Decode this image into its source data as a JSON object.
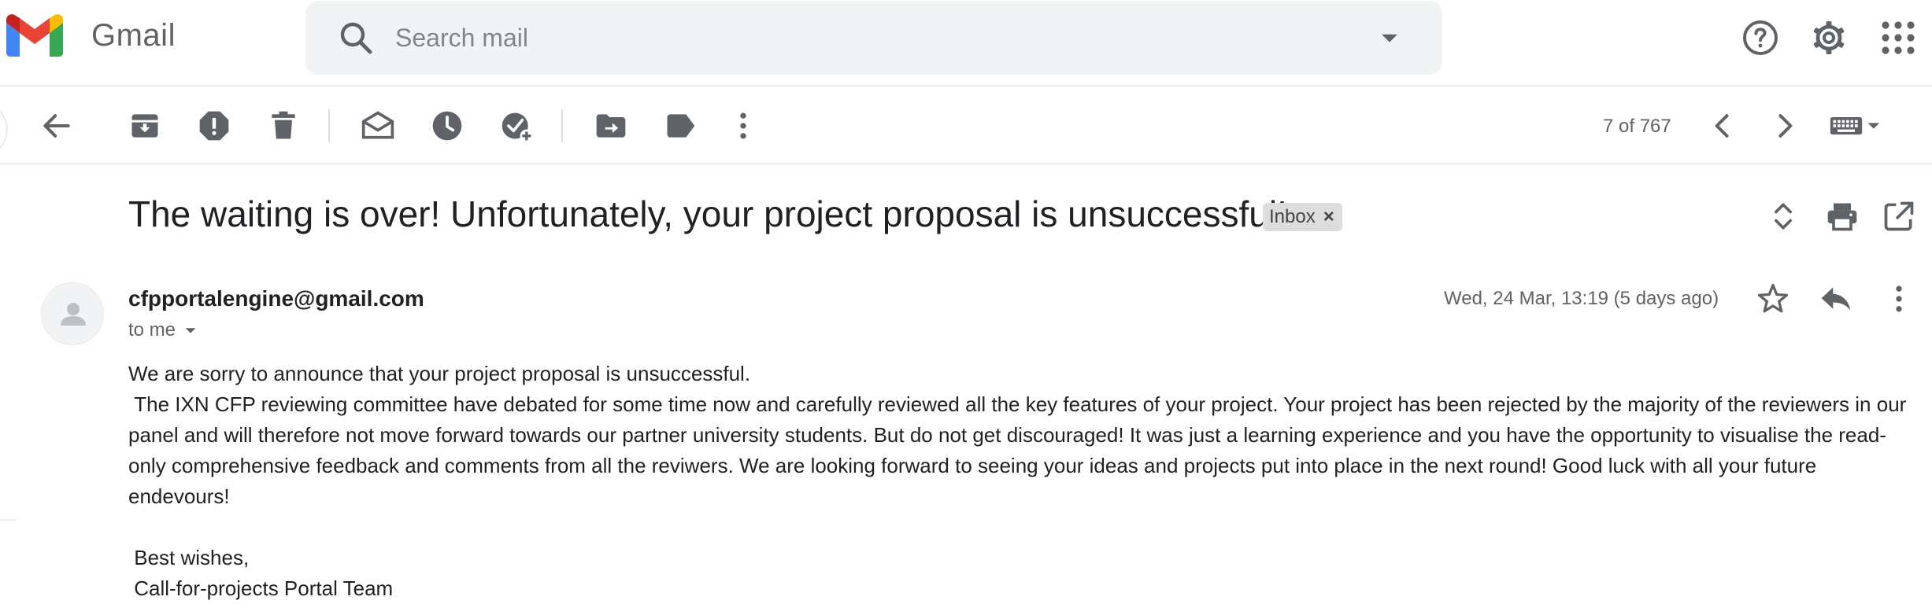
{
  "app": {
    "name": "Gmail",
    "brand_colors": {
      "red": "#ea4335",
      "blue": "#4285f4",
      "green": "#34a853",
      "yellow": "#fbbc04"
    }
  },
  "search": {
    "placeholder": "Search mail",
    "value": "",
    "icon": "search-icon",
    "options_icon": "dropdown-arrow-icon"
  },
  "header_icons": [
    "help-icon",
    "settings-icon",
    "apps-grid-icon"
  ],
  "toolbar": {
    "actions": [
      "back-arrow-icon",
      "archive-icon",
      "report-spam-icon",
      "delete-icon",
      "mark-unread-icon",
      "snooze-icon",
      "add-to-tasks-icon",
      "move-to-icon",
      "labels-icon",
      "more-vertical-icon"
    ],
    "pager": {
      "current": 7,
      "total": 767,
      "text": "7 of 767"
    },
    "input_tools": "keyboard-icon"
  },
  "email": {
    "subject": "The waiting is over! Unfortunately, your project proposal is unsuccessful!",
    "label": "Inbox",
    "label_remove": "×",
    "sender": "cfpportalengine@gmail.com",
    "recipient": "to me",
    "date": "Wed, 24 Mar, 13:19 (5 days ago)",
    "body": {
      "line1": "We are sorry to announce that your project proposal is unsuccessful.",
      "paragraph": " The IXN CFP reviewing committee have debated for some time now and carefully reviewed all the key features of your project. Your project has been rejected by the majority of the reviewers in our panel and will therefore not move forward towards our partner university students. But do not get discouraged! It was just a learning experience and you have the opportunity to visualise the read-only comprehensive feedback and comments from all the reviwers. We are looking forward to seeing your ideas and projects put into place in the next round! Good luck with all your future endevours!",
      "closing": " Best wishes,",
      "signature": " Call-for-projects Portal Team"
    }
  }
}
